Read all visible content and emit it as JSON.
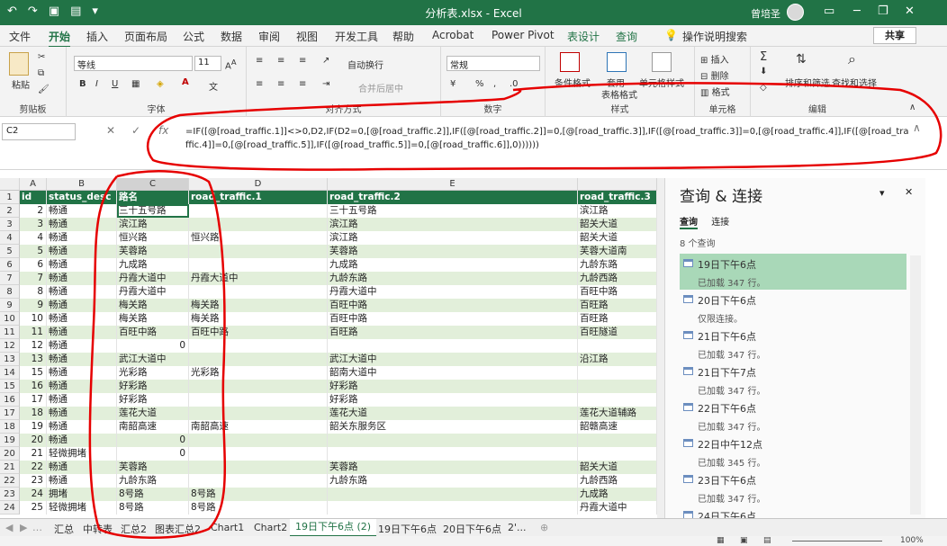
{
  "window": {
    "title": "分析表.xlsx - Excel",
    "user_name": "曾培圣"
  },
  "ribbon_tabs": [
    "文件",
    "开始",
    "插入",
    "页面布局",
    "公式",
    "数据",
    "审阅",
    "视图",
    "开发工具",
    "帮助",
    "Acrobat",
    "Power Pivot",
    "表设计",
    "查询"
  ],
  "tell_me": "操作说明搜索",
  "share_label": "共享",
  "ribbon": {
    "paste_label": "粘贴",
    "clipboard_label": "剪贴板",
    "font_name": "等线",
    "font_size": "11",
    "font_group_label": "字体",
    "wrap_label": "自动换行",
    "merge_label": "合并后居中",
    "align_group_label": "对齐方式",
    "number_format": "常规",
    "number_group_label": "数字",
    "cond_format_label": "条件格式",
    "table_format_label": "套用",
    "table_format_label2": "表格格式",
    "cell_style_label": "单元格样式",
    "style_group_label": "样式",
    "insert_label": "插入",
    "delete_label": "删除",
    "format_label": "格式",
    "cells_group_label": "单元格",
    "sort_label": "排序和筛选",
    "find_label": "查找和选择",
    "edit_group_label": "编辑"
  },
  "formula_bar": {
    "name_box": "C2",
    "fx": "fx",
    "formula": "=IF([@[road_traffic.1]]<>0,D2,IF(D2=0,[@[road_traffic.2]],IF([@[road_traffic.2]]=0,[@[road_traffic.3]],IF([@[road_traffic.3]]=0,[@[road_traffic.4]],IF([@[road_traffic.4]]=0,[@[road_traffic.5]],IF([@[road_traffic.5]]=0,[@[road_traffic.6]],0))))))"
  },
  "columns": [
    "A",
    "B",
    "C",
    "D",
    "E",
    ""
  ],
  "header_row": [
    "id",
    "status_desc",
    "路名",
    "road_traffic.1",
    "road_traffic.2",
    "road_traffic.3"
  ],
  "rows": [
    [
      "2",
      "畅通",
      "三十五号路",
      "",
      "三十五号路",
      "滨江路"
    ],
    [
      "3",
      "畅通",
      "滨江路",
      "",
      "滨江路",
      "韶关大道"
    ],
    [
      "4",
      "畅通",
      "恒兴路",
      "恒兴路",
      "滨江路",
      "韶关大道"
    ],
    [
      "5",
      "畅通",
      "芙蓉路",
      "",
      "芙蓉路",
      "芙蓉大道南"
    ],
    [
      "6",
      "畅通",
      "九成路",
      "",
      "九成路",
      "九龄东路"
    ],
    [
      "7",
      "畅通",
      "丹霞大道中",
      "丹霞大道中",
      "九龄东路",
      "九龄西路"
    ],
    [
      "8",
      "畅通",
      "丹霞大道中",
      "",
      "丹霞大道中",
      "百旺中路"
    ],
    [
      "9",
      "畅通",
      "梅关路",
      "梅关路",
      "百旺中路",
      "百旺路"
    ],
    [
      "10",
      "畅通",
      "梅关路",
      "梅关路",
      "百旺中路",
      "百旺路"
    ],
    [
      "11",
      "畅通",
      "百旺中路",
      "百旺中路",
      "百旺路",
      "百旺隧道"
    ],
    [
      "12",
      "畅通",
      "0",
      "",
      "",
      ""
    ],
    [
      "13",
      "畅通",
      "武江大道中",
      "",
      "武江大道中",
      "沿江路"
    ],
    [
      "15",
      "畅通",
      "光彩路",
      "光彩路",
      "韶南大道中",
      ""
    ],
    [
      "16",
      "畅通",
      "好彩路",
      "",
      "好彩路",
      ""
    ],
    [
      "17",
      "畅通",
      "好彩路",
      "",
      "好彩路",
      ""
    ],
    [
      "18",
      "畅通",
      "莲花大道",
      "",
      "莲花大道",
      "莲花大道辅路"
    ],
    [
      "19",
      "畅通",
      "南韶高速",
      "南韶高速",
      "韶关东服务区",
      "韶赣高速"
    ],
    [
      "20",
      "畅通",
      "0",
      "",
      "",
      ""
    ],
    [
      "21",
      "轻微拥堵",
      "0",
      "",
      "",
      ""
    ],
    [
      "22",
      "畅通",
      "芙蓉路",
      "",
      "芙蓉路",
      "韶关大道"
    ],
    [
      "23",
      "畅通",
      "九龄东路",
      "",
      "九龄东路",
      "九龄西路"
    ],
    [
      "24",
      "拥堵",
      "8号路",
      "8号路",
      "",
      "九成路"
    ],
    [
      "25",
      "轻微拥堵",
      "8号路",
      "8号路",
      "",
      "丹霞大道中"
    ]
  ],
  "pane": {
    "title": "查询 & 连接",
    "tab_queries": "查询",
    "tab_connections": "连接",
    "count": "8 个查询",
    "queries": [
      {
        "name": "19日下午6点",
        "status": "已加载 347 行。"
      },
      {
        "name": "20日下午6点",
        "status": "仅限连接。"
      },
      {
        "name": "21日下午6点",
        "status": "已加载 347 行。"
      },
      {
        "name": "21日下午7点",
        "status": "已加载 347 行。"
      },
      {
        "name": "22日下午6点",
        "status": "已加载 347 行。"
      },
      {
        "name": "22日中午12点",
        "status": "已加载 345 行。"
      },
      {
        "name": "23日下午6点",
        "status": "已加载 347 行。"
      },
      {
        "name": "24日下午6点",
        "status": ""
      }
    ]
  },
  "sheet_tabs": [
    "汇总",
    "中转表",
    "汇总2",
    "图表汇总2",
    "Chart1",
    "Chart2",
    "19日下午6点 (2)",
    "19日下午6点",
    "20日下午6点",
    "2'..."
  ],
  "status": {
    "zoom": "100%"
  },
  "colors": {
    "accent": "#217346",
    "band": "#e2efda",
    "annotation": "#e60000"
  }
}
